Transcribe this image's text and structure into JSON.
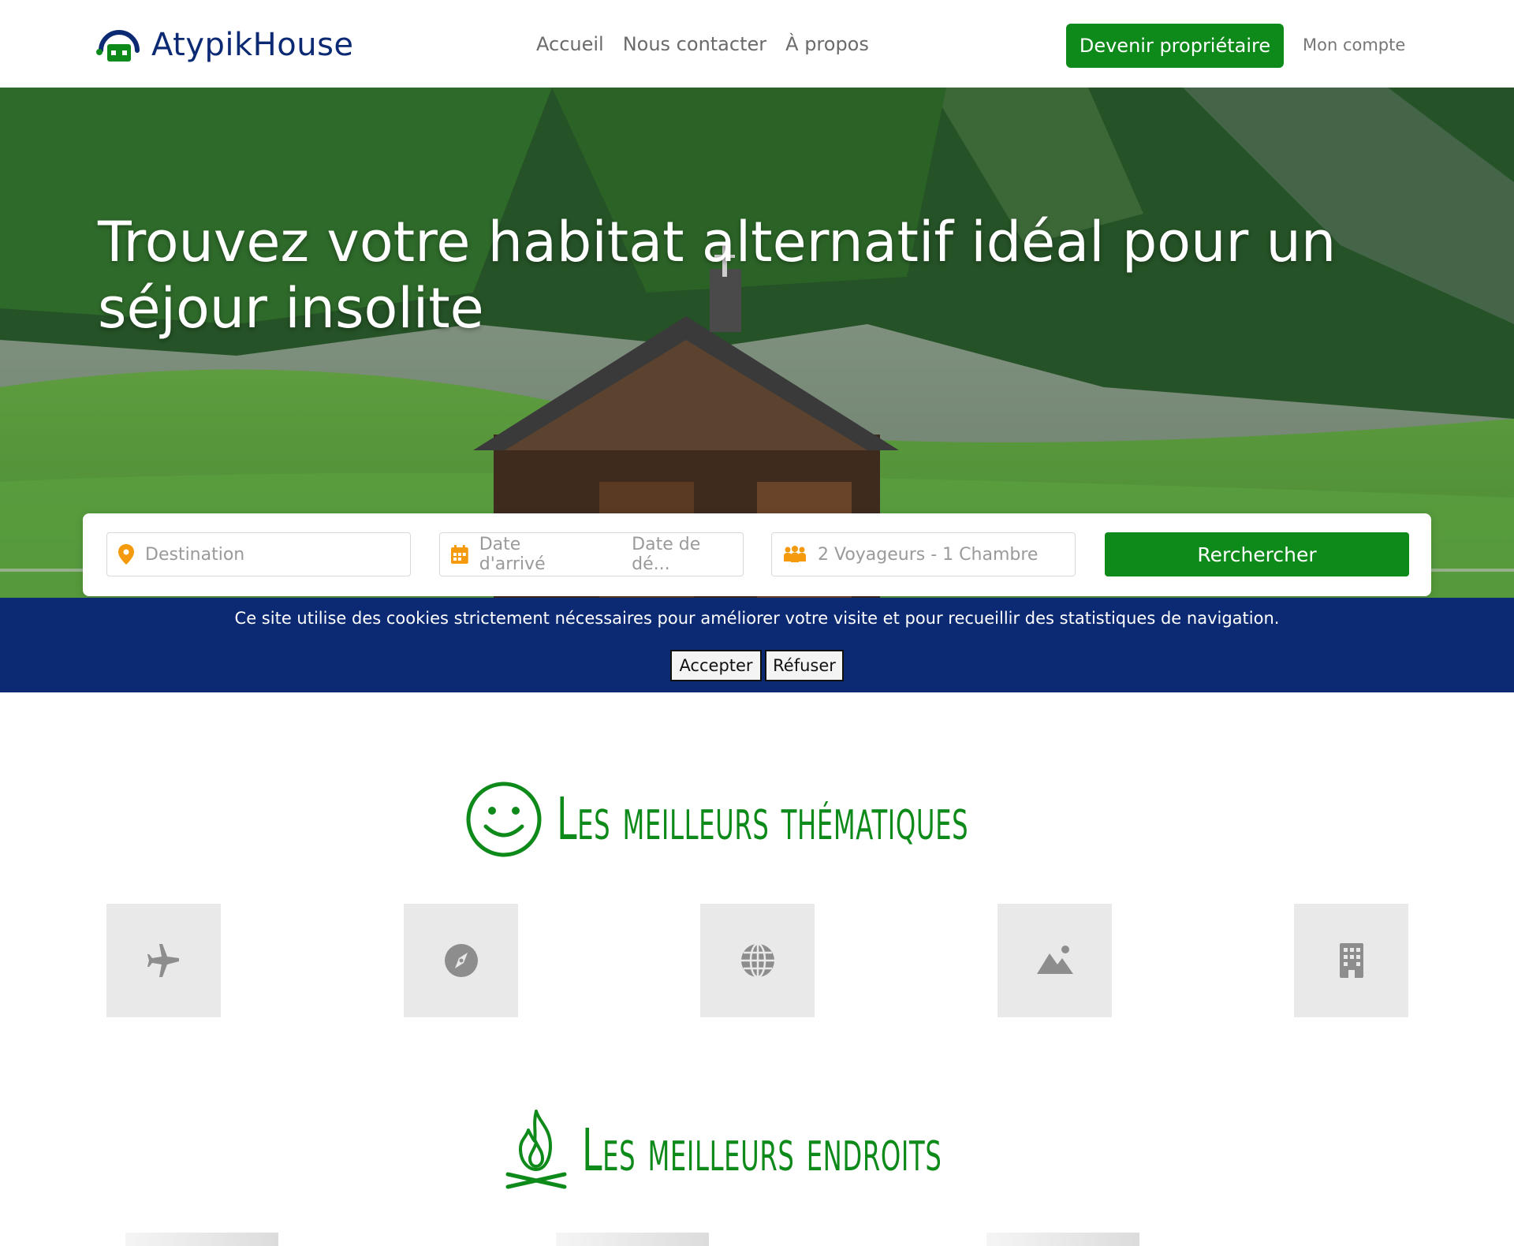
{
  "header": {
    "brand": "AtypikHouse",
    "nav": [
      "Accueil",
      "Nous contacter",
      "À propos"
    ],
    "owner_button": "Devenir propriétaire",
    "account_link": "Mon compte"
  },
  "hero": {
    "title": "Trouvez votre habitat alternatif idéal pour un séjour insolite"
  },
  "search": {
    "destination_placeholder": "Destination",
    "arrival_placeholder": "Date d'arrivé",
    "departure_placeholder": "Date de dé...",
    "guests_value": "2 Voyageurs - 1 Chambre",
    "submit_label": "Rerchercher"
  },
  "cookie": {
    "message": "Ce site utilise des cookies strictement nécessaires pour améliorer votre visite et pour recueillir des statistiques de navigation.",
    "accept_label": "Accepter",
    "refuse_label": "Réfuser"
  },
  "sections": {
    "themes_title": "Les meilleurs thématiques",
    "places_title": "Les meilleurs endroits"
  },
  "themes": [
    {
      "icon": "airplane-icon"
    },
    {
      "icon": "compass-icon"
    },
    {
      "icon": "globe-icon"
    },
    {
      "icon": "landscape-icon"
    },
    {
      "icon": "building-icon"
    }
  ],
  "colors": {
    "brand_green": "#0e8a1a",
    "brand_navy": "#0c2a73",
    "accent_orange": "#f59a0c"
  }
}
